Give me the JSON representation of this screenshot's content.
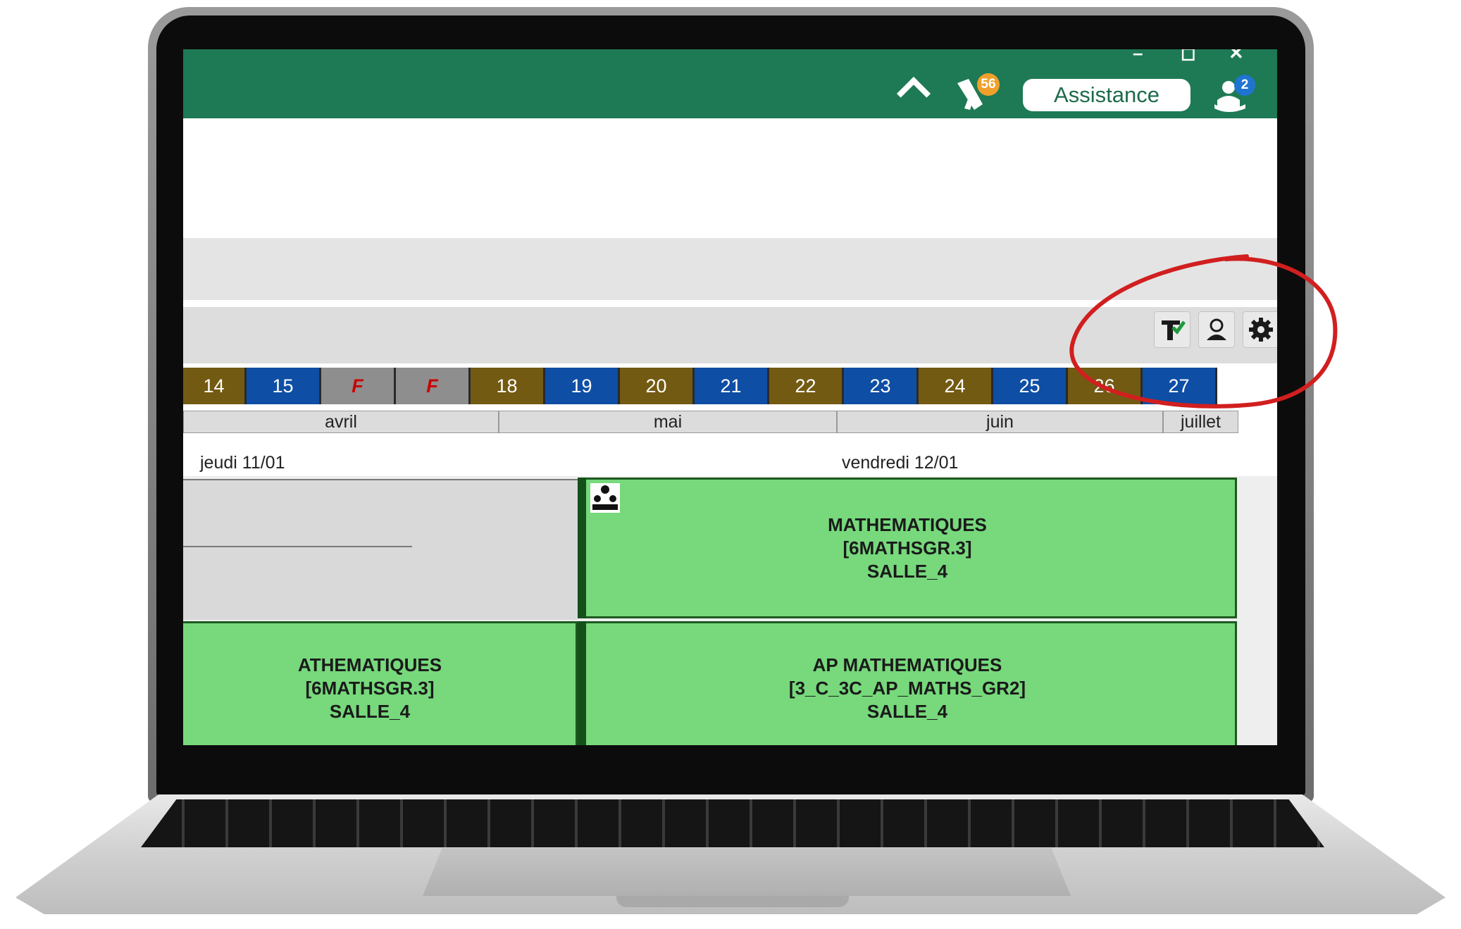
{
  "topbar": {
    "window_controls": [
      "–",
      "◻",
      "✕"
    ],
    "notification_count": "56",
    "assistance_label": "Assistance",
    "messages_count": "2",
    "colors": {
      "bar": "#1d7a55"
    }
  },
  "toolbar": {
    "icons": [
      "tick-filter-icon",
      "user-icon",
      "gear-icon"
    ]
  },
  "weeks": [
    {
      "label": "14",
      "color": "#735a12"
    },
    {
      "label": "15",
      "color": "#0e4ea4"
    },
    {
      "label": "F",
      "color": "#8e8e8e",
      "holiday": true
    },
    {
      "label": "F",
      "color": "#8e8e8e",
      "holiday": true
    },
    {
      "label": "18",
      "color": "#735a12"
    },
    {
      "label": "19",
      "color": "#0e4ea4"
    },
    {
      "label": "20",
      "color": "#735a12"
    },
    {
      "label": "21",
      "color": "#0e4ea4"
    },
    {
      "label": "22",
      "color": "#735a12"
    },
    {
      "label": "23",
      "color": "#0e4ea4"
    },
    {
      "label": "24",
      "color": "#735a12"
    },
    {
      "label": "25",
      "color": "#0e4ea4"
    },
    {
      "label": "26",
      "color": "#735a12"
    },
    {
      "label": "27",
      "color": "#0e4ea4"
    }
  ],
  "months": [
    "avril",
    "mai",
    "juin",
    "juillet"
  ],
  "days": {
    "thursday": "jeudi 11/01",
    "friday": "vendredi 12/01"
  },
  "courses": {
    "friday_first": [
      "MATHEMATIQUES",
      "[6MATHSGR.3]",
      "SALLE_4"
    ],
    "thursday_second": [
      "ATHEMATIQUES",
      "[6MATHSGR.3]",
      "SALLE_4"
    ],
    "friday_second": [
      "AP MATHEMATIQUES",
      "[3_C_3C_AP_MATHS_GR2]",
      "SALLE_4"
    ]
  }
}
